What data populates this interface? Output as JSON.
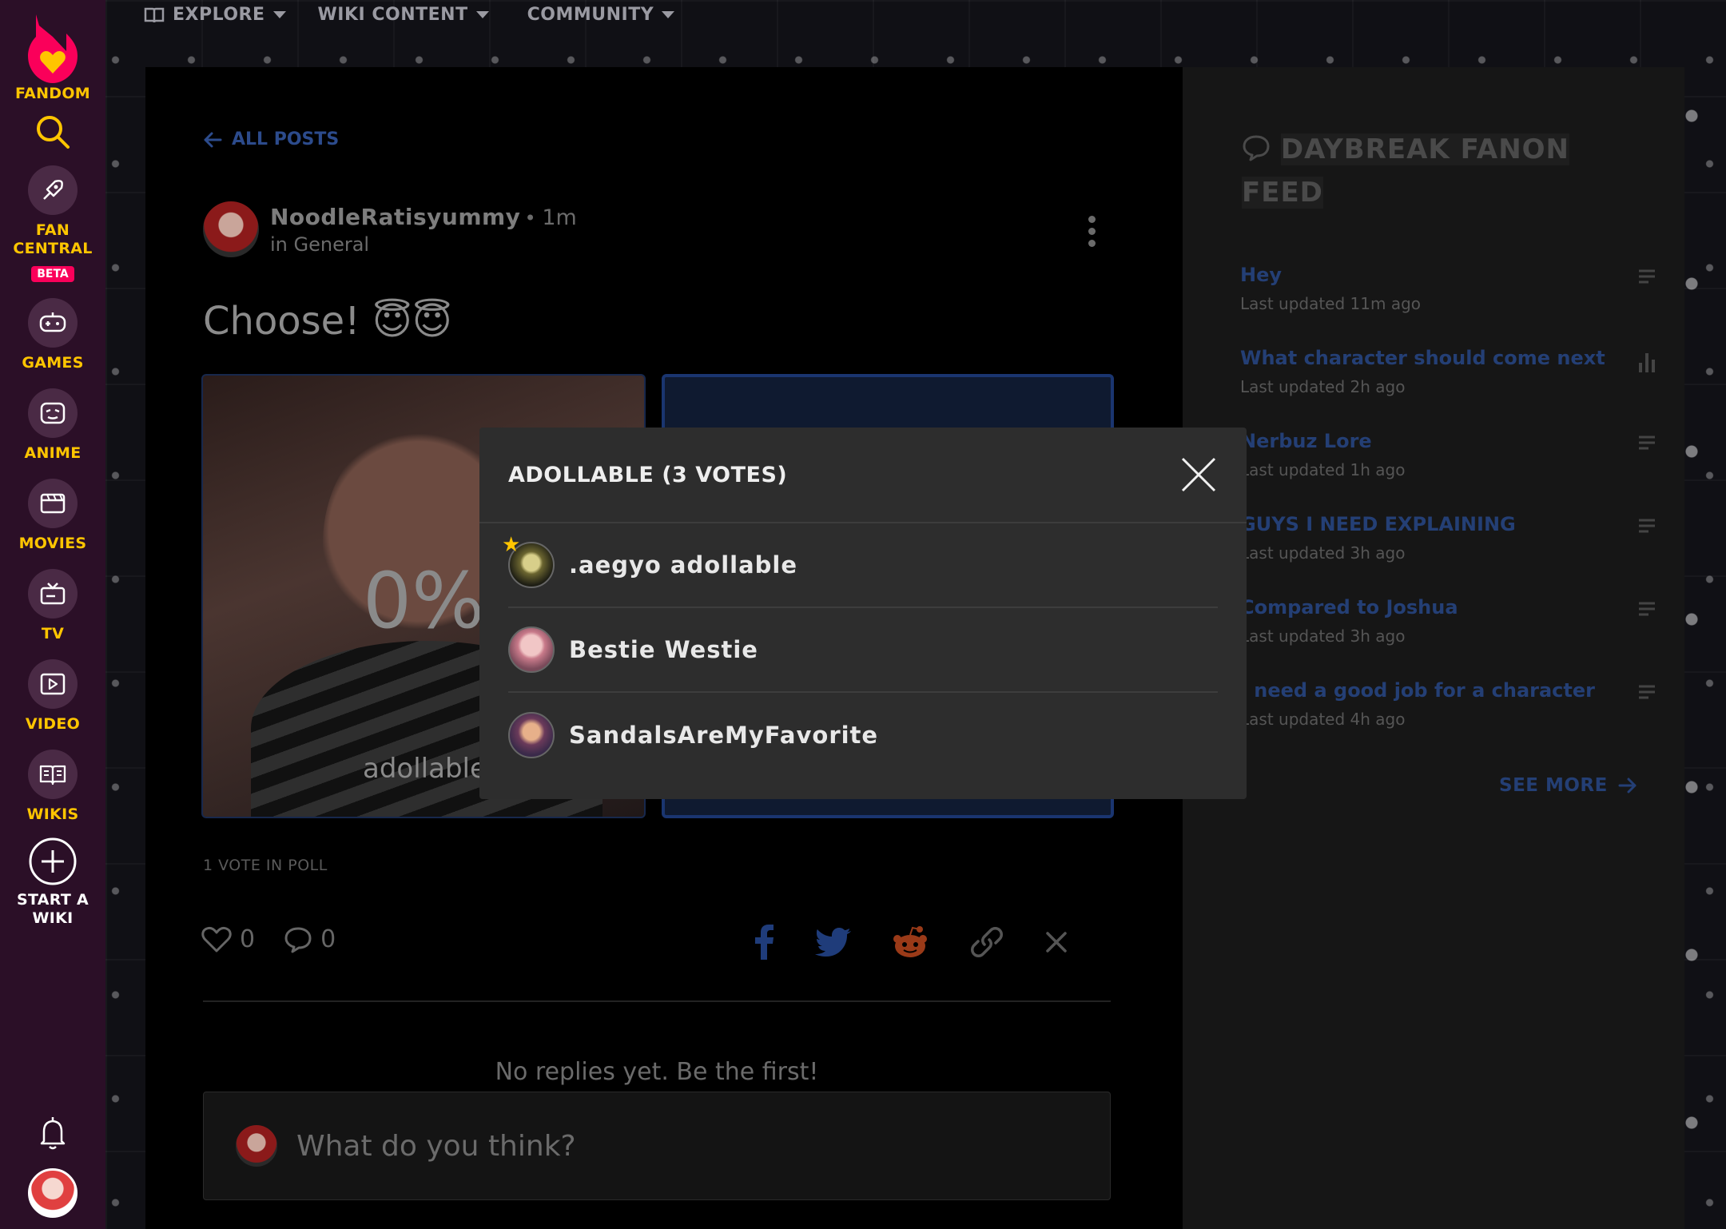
{
  "nav": {
    "brand": "FANDOM",
    "items": [
      {
        "label": "FAN\nCENTRAL",
        "icon": "rocket-icon",
        "badge": "BETA"
      },
      {
        "label": "GAMES",
        "icon": "gamepad-icon"
      },
      {
        "label": "ANIME",
        "icon": "anime-face-icon"
      },
      {
        "label": "MOVIES",
        "icon": "clapperboard-icon"
      },
      {
        "label": "TV",
        "icon": "tv-icon"
      },
      {
        "label": "VIDEO",
        "icon": "play-icon"
      },
      {
        "label": "WIKIS",
        "icon": "book-icon"
      }
    ],
    "start_wiki": "START A\nWIKI"
  },
  "topbar": {
    "explore": "EXPLORE",
    "wiki_content": "WIKI CONTENT",
    "community": "COMMUNITY"
  },
  "post": {
    "back_link": "ALL POSTS",
    "author": "NoodleRatisyummy",
    "time": "1m",
    "category": "in General",
    "title": "Choose! 😇😇",
    "option_a": {
      "percent": "0%",
      "label": "adollable"
    },
    "votes_in_poll": "1 VOTE IN POLL",
    "likes": "0",
    "comments": "0",
    "no_replies": "No replies yet. Be the first!",
    "reply_placeholder": "What do you think?"
  },
  "rail": {
    "title": "DAYBREAK FANON FEED",
    "items": [
      {
        "title": "Hey",
        "time": "Last updated 11m ago",
        "icon": "lines-icon"
      },
      {
        "title": "What character should come next",
        "time": "Last updated 2h ago",
        "icon": "bar-chart-icon"
      },
      {
        "title": "Nerbuz Lore",
        "time": "Last updated 1h ago",
        "icon": "lines-icon"
      },
      {
        "title": "GUYS I NEED EXPLAINING",
        "time": "Last updated 3h ago",
        "icon": "lines-icon"
      },
      {
        "title": "Compared to Joshua",
        "time": "Last updated 3h ago",
        "icon": "lines-icon"
      },
      {
        "title": "I need a good job for a character",
        "time": "Last updated 4h ago",
        "icon": "lines-icon"
      }
    ],
    "see_more": "SEE MORE"
  },
  "modal": {
    "title": "ADOLLABLE (3 VOTES)",
    "voters": [
      {
        "name": ".aegyo adollable"
      },
      {
        "name": "Bestie Westie"
      },
      {
        "name": "SandalsAreMyFavorite"
      }
    ]
  },
  "colors": {
    "nav_bg": "#2b0f27",
    "accent_yellow": "#ffc500",
    "link_blue": "#243f75",
    "beta_pink": "#fa005a"
  }
}
